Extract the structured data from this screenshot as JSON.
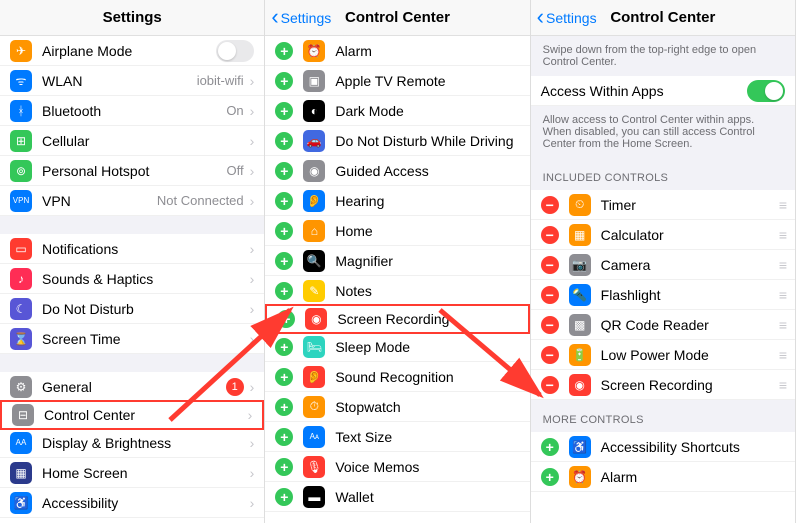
{
  "panel1": {
    "title": "Settings",
    "rows": [
      {
        "icon": "airplane",
        "bg": "#ff9500",
        "glyph": "✈",
        "label": "Airplane Mode",
        "type": "toggle-off"
      },
      {
        "icon": "wlan",
        "bg": "#007aff",
        "glyph": "ᯤ",
        "label": "WLAN",
        "value": "iobit-wifi",
        "type": "chev"
      },
      {
        "icon": "bluetooth",
        "bg": "#007aff",
        "glyph": "ᚼ",
        "label": "Bluetooth",
        "value": "On",
        "type": "chev"
      },
      {
        "icon": "cellular",
        "bg": "#34c759",
        "glyph": "⊞",
        "label": "Cellular",
        "type": "chev"
      },
      {
        "icon": "hotspot",
        "bg": "#34c759",
        "glyph": "⊚",
        "label": "Personal Hotspot",
        "value": "Off",
        "type": "chev"
      },
      {
        "icon": "vpn",
        "bg": "#007aff",
        "glyph": "VPN",
        "label": "VPN",
        "value": "Not Connected",
        "type": "chev",
        "textIcon": true
      },
      {
        "type": "gap"
      },
      {
        "icon": "notifications",
        "bg": "#ff3b30",
        "glyph": "▭",
        "label": "Notifications",
        "type": "chev"
      },
      {
        "icon": "sounds",
        "bg": "#ff2d55",
        "glyph": "♪",
        "label": "Sounds & Haptics",
        "type": "chev"
      },
      {
        "icon": "dnd",
        "bg": "#5856d6",
        "glyph": "☾",
        "label": "Do Not Disturb",
        "type": "chev"
      },
      {
        "icon": "screentime",
        "bg": "#5856d6",
        "glyph": "⌛",
        "label": "Screen Time",
        "type": "chev"
      },
      {
        "type": "gap"
      },
      {
        "icon": "general",
        "bg": "#8e8e93",
        "glyph": "⚙",
        "label": "General",
        "badge": "1",
        "type": "chev"
      },
      {
        "icon": "control-center",
        "bg": "#8e8e93",
        "glyph": "⊟",
        "label": "Control Center",
        "type": "chev",
        "highlight": true
      },
      {
        "icon": "display",
        "bg": "#007aff",
        "glyph": "AA",
        "label": "Display & Brightness",
        "type": "chev",
        "textIcon": true
      },
      {
        "icon": "homescreen",
        "bg": "#2b3a8c",
        "glyph": "▦",
        "label": "Home Screen",
        "type": "chev"
      },
      {
        "icon": "accessibility",
        "bg": "#007aff",
        "glyph": "♿",
        "label": "Accessibility",
        "type": "chev"
      }
    ]
  },
  "panel2": {
    "title": "Control Center",
    "back": "Settings",
    "rows": [
      {
        "icon": "alarm",
        "bg": "#ff9500",
        "glyph": "⏰",
        "label": "Alarm"
      },
      {
        "icon": "appletv",
        "bg": "#8e8e93",
        "glyph": "▣",
        "label": "Apple TV Remote"
      },
      {
        "icon": "darkmode",
        "bg": "#000",
        "glyph": "◐",
        "label": "Dark Mode"
      },
      {
        "icon": "dnd-drive",
        "bg": "#4169e1",
        "glyph": "🚗",
        "label": "Do Not Disturb While Driving"
      },
      {
        "icon": "guided",
        "bg": "#8e8e93",
        "glyph": "◉",
        "label": "Guided Access"
      },
      {
        "icon": "hearing",
        "bg": "#007aff",
        "glyph": "👂",
        "label": "Hearing"
      },
      {
        "icon": "home",
        "bg": "#ff9500",
        "glyph": "⌂",
        "label": "Home"
      },
      {
        "icon": "magnifier",
        "bg": "#000",
        "glyph": "🔍",
        "label": "Magnifier"
      },
      {
        "icon": "notes",
        "bg": "#ffcc00",
        "glyph": "✎",
        "label": "Notes"
      },
      {
        "icon": "screenrec",
        "bg": "#ff3b30",
        "glyph": "◉",
        "label": "Screen Recording",
        "highlight": true
      },
      {
        "icon": "sleep",
        "bg": "#2dd4bf",
        "glyph": "🛏",
        "label": "Sleep Mode"
      },
      {
        "icon": "soundrec",
        "bg": "#ff3b30",
        "glyph": "👂",
        "label": "Sound Recognition"
      },
      {
        "icon": "stopwatch",
        "bg": "#ff9500",
        "glyph": "⏱",
        "label": "Stopwatch"
      },
      {
        "icon": "textsize",
        "bg": "#007aff",
        "glyph": "Aᴀ",
        "label": "Text Size",
        "textIcon": true
      },
      {
        "icon": "voicememo",
        "bg": "#ff3b30",
        "glyph": "🎙",
        "label": "Voice Memos"
      },
      {
        "icon": "wallet",
        "bg": "#000",
        "glyph": "▬",
        "label": "Wallet"
      }
    ]
  },
  "panel3": {
    "title": "Control Center",
    "back": "Settings",
    "desc": "Swipe down from the top-right edge to open Control Center.",
    "access_label": "Access Within Apps",
    "access_desc": "Allow access to Control Center within apps. When disabled, you can still access Control Center from the Home Screen.",
    "included_header": "INCLUDED CONTROLS",
    "more_header": "MORE CONTROLS",
    "included": [
      {
        "icon": "timer",
        "bg": "#ff9500",
        "glyph": "⏲",
        "label": "Timer"
      },
      {
        "icon": "calculator",
        "bg": "#ff9500",
        "glyph": "▦",
        "label": "Calculator"
      },
      {
        "icon": "camera",
        "bg": "#8e8e93",
        "glyph": "📷",
        "label": "Camera"
      },
      {
        "icon": "flashlight",
        "bg": "#007aff",
        "glyph": "🔦",
        "label": "Flashlight"
      },
      {
        "icon": "qr",
        "bg": "#8e8e93",
        "glyph": "▩",
        "label": "QR Code Reader"
      },
      {
        "icon": "lowpower",
        "bg": "#ff9500",
        "glyph": "🔋",
        "label": "Low Power Mode"
      },
      {
        "icon": "screenrec",
        "bg": "#ff3b30",
        "glyph": "◉",
        "label": "Screen Recording"
      }
    ],
    "more": [
      {
        "icon": "a11y",
        "bg": "#007aff",
        "glyph": "♿",
        "label": "Accessibility Shortcuts"
      },
      {
        "icon": "alarm",
        "bg": "#ff9500",
        "glyph": "⏰",
        "label": "Alarm"
      }
    ]
  }
}
